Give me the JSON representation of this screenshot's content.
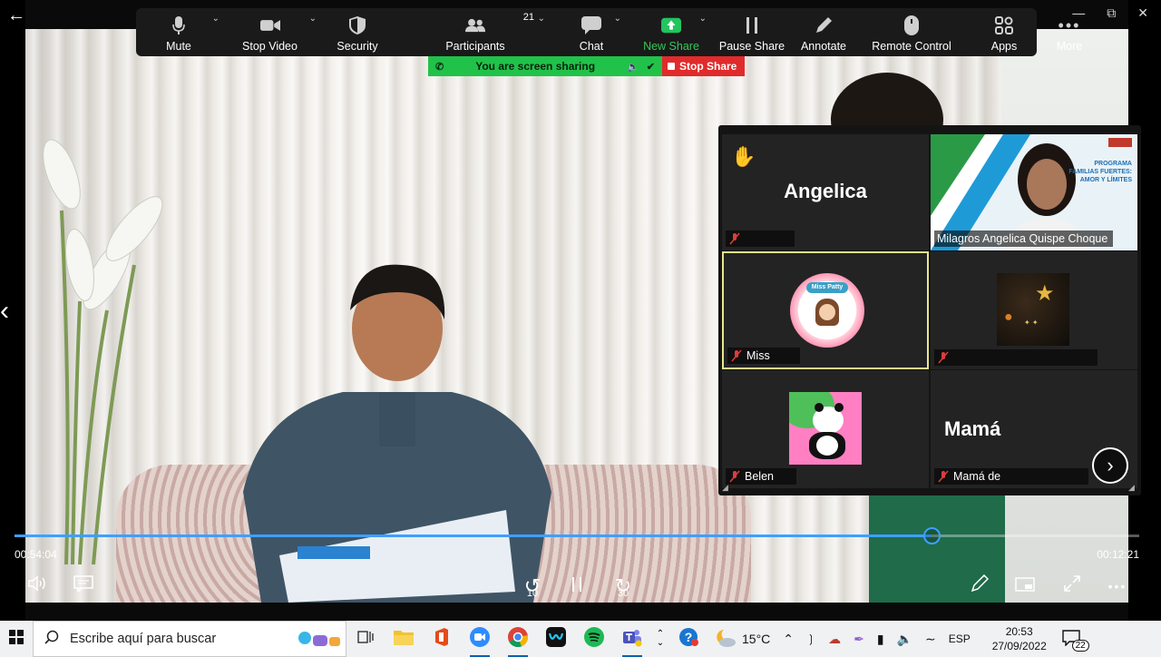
{
  "toolbar": {
    "items": [
      {
        "label": "Mute",
        "icon": "microphone-icon"
      },
      {
        "label": "Stop Video",
        "icon": "video-camera-icon"
      },
      {
        "label": "Security",
        "icon": "shield-icon"
      },
      {
        "label": "Participants",
        "icon": "participants-icon",
        "count": "21"
      },
      {
        "label": "Chat",
        "icon": "chat-icon"
      },
      {
        "label": "New Share",
        "icon": "share-arrow-icon"
      },
      {
        "label": "Pause Share",
        "icon": "pause-icon"
      },
      {
        "label": "Annotate",
        "icon": "pencil-icon"
      },
      {
        "label": "Remote Control",
        "icon": "mouse-icon"
      },
      {
        "label": "Apps",
        "icon": "apps-icon"
      },
      {
        "label": "More",
        "icon": "more-dots-icon"
      }
    ]
  },
  "share_bar": {
    "status": "You are screen sharing",
    "stop_label": "Stop Share"
  },
  "gallery": {
    "tiles": [
      {
        "big_name": "Angelica",
        "name": "",
        "hand_raised": true
      },
      {
        "big_name": "",
        "name": "Milagros Angelica Quispe Choque",
        "slide_text": "PROGRAMA FAMILIAS FUERTES: AMOR Y LÍMITES"
      },
      {
        "big_name": "",
        "name": "Miss",
        "avatar_text": "Miss Patty",
        "active": true
      },
      {
        "big_name": "",
        "name": ""
      },
      {
        "big_name": "",
        "name": "Belen"
      },
      {
        "big_name": "Mamá",
        "name": "Mamá de"
      }
    ]
  },
  "player": {
    "elapsed": "00:54:04",
    "remaining": "00:12:21",
    "progress": 0.815,
    "rewind_label": "10",
    "forward_label": "30"
  },
  "taskbar": {
    "search_placeholder": "Escribe aquí para buscar",
    "weather": "15°C",
    "language": "ESP",
    "time": "20:53",
    "date": "27/09/2022",
    "notifications": "22"
  },
  "colors": {
    "accent_green": "#21c249",
    "stop_red": "#e12b2b",
    "progress_blue": "#3ea0ff",
    "active_tile_border": "#e8e68b"
  }
}
